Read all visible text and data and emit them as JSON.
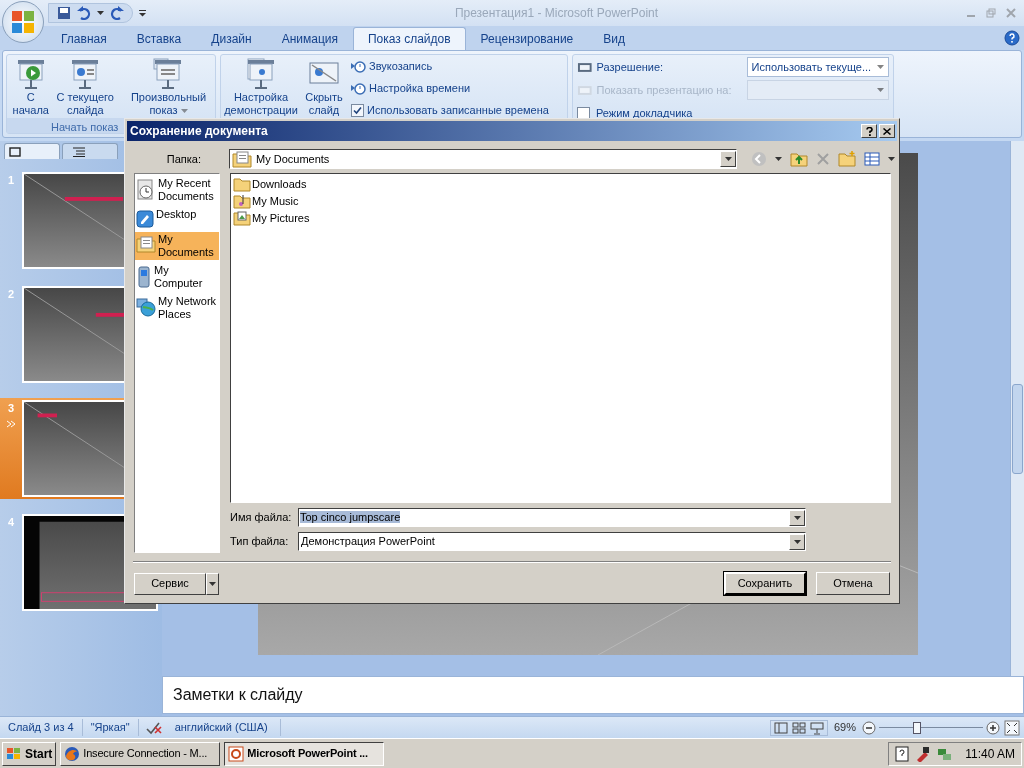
{
  "window": {
    "title": "Презентация1 - Microsoft PowerPoint"
  },
  "ribbon_tabs": [
    {
      "label": "Главная",
      "selected": false
    },
    {
      "label": "Вставка",
      "selected": false
    },
    {
      "label": "Дизайн",
      "selected": false
    },
    {
      "label": "Анимация",
      "selected": false
    },
    {
      "label": "Показ слайдов",
      "selected": true
    },
    {
      "label": "Рецензирование",
      "selected": false
    },
    {
      "label": "Вид",
      "selected": false
    }
  ],
  "ribbon": {
    "start_group": {
      "label": "Начать показ",
      "buttons": [
        {
          "kind": "play",
          "label": "С начала"
        },
        {
          "kind": "current",
          "label": "С текущего слайда"
        },
        {
          "kind": "custom",
          "label": "Произвольный показ"
        }
      ]
    },
    "setup_group": {
      "buttons": [
        {
          "kind": "setup",
          "label": "Настройка демонстрации"
        },
        {
          "kind": "hide",
          "label": "Скрыть слайд"
        }
      ],
      "items": [
        {
          "kind": "button",
          "label": "Звукозапись",
          "disabled": false
        },
        {
          "kind": "button",
          "label": "Настройка времени",
          "disabled": false
        },
        {
          "kind": "checkbox",
          "label": "Использовать записанные времена",
          "checked": true,
          "disabled": false
        }
      ]
    },
    "monitors_group": {
      "items": [
        {
          "kind": "dropdown",
          "label": "Разрешение:",
          "value": "Использовать текуще...",
          "disabled": false
        },
        {
          "kind": "dropdown",
          "label": "Показать презентацию на:",
          "disabled": true
        },
        {
          "kind": "checkbox",
          "label": "Режим докладчика",
          "checked": false,
          "disabled": false
        }
      ]
    }
  },
  "slides": [
    {
      "number": "1",
      "selected": false,
      "animated": false
    },
    {
      "number": "2",
      "selected": false,
      "animated": false
    },
    {
      "number": "3",
      "selected": true,
      "animated": true
    },
    {
      "number": "4",
      "selected": false,
      "animated": false
    }
  ],
  "notes": {
    "placeholder": "Заметки к слайду"
  },
  "status_bar": {
    "slide": "Слайд 3 из 4",
    "theme": "\"Яркая\"",
    "language": "английский (США)",
    "zoom": "69%",
    "zoom_slider": {
      "level": 0.35
    }
  },
  "dialog": {
    "title": "Сохранение документа",
    "folder_label": "Папка:",
    "folder": "My Documents",
    "places": [
      {
        "kind": "recent",
        "label": "My Recent Documents",
        "selected": false
      },
      {
        "kind": "desktop",
        "label": "Desktop",
        "selected": false
      },
      {
        "kind": "documents",
        "label": "My Documents",
        "selected": true
      },
      {
        "kind": "computer",
        "label": "My Computer",
        "selected": false
      },
      {
        "kind": "network",
        "label": "My Network Places",
        "selected": false
      }
    ],
    "files": [
      {
        "kind": "folder",
        "name": "Downloads"
      },
      {
        "kind": "music",
        "name": "My Music"
      },
      {
        "kind": "pictures",
        "name": "My Pictures"
      }
    ],
    "filename_label": "Имя файла:",
    "filename": "Top cinco jumpscare",
    "filename_highlighted": true,
    "filetype_label": "Тип файла:",
    "filetype": "Демонстрация PowerPoint",
    "buttons": {
      "tools": "Сервис",
      "save": "Сохранить",
      "cancel": "Отмена"
    }
  },
  "taskbar": {
    "start": "Start",
    "items": [
      {
        "kind": "browser",
        "label": "Insecure Connection - M...",
        "selected": false
      },
      {
        "kind": "powerpoint",
        "label": "Microsoft PowerPoint ...",
        "selected": true
      }
    ],
    "time": "11:40 AM"
  }
}
